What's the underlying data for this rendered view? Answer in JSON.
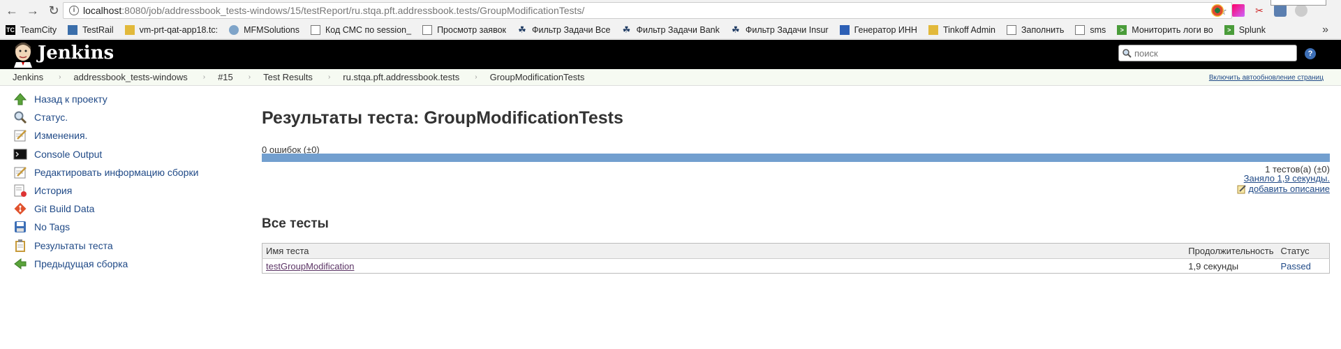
{
  "browser": {
    "url_host": "localhost",
    "url_rest": ":8080/job/addressbook_tests-windows/15/testReport/ru.stqa.pft.addressbook.tests/GroupModificationTests/",
    "bookmarks": [
      {
        "label": "TeamCity",
        "icon": "teamcity-icon",
        "color": "#000000"
      },
      {
        "label": "TestRail",
        "icon": "testrail-icon",
        "color": "#3b6eaa"
      },
      {
        "label": "vm-prt-qat-app18.tc:",
        "icon": "folder-icon",
        "color": "#e2b93b"
      },
      {
        "label": "MFMSolutions",
        "icon": "mfm-icon",
        "color": "#7fa4c9"
      },
      {
        "label": "Код СМС по session_",
        "icon": "page-icon",
        "color": "#ffffff"
      },
      {
        "label": "Просмотр заявок",
        "icon": "page-icon",
        "color": "#ffffff"
      },
      {
        "label": "Фильтр Задачи Все",
        "icon": "jira-icon",
        "color": "#1f3b63"
      },
      {
        "label": "Фильтр Задачи Bank",
        "icon": "jira-icon",
        "color": "#1f3b63"
      },
      {
        "label": "Фильтр Задачи Insur",
        "icon": "jira-icon",
        "color": "#1f3b63"
      },
      {
        "label": "Генератор ИНН",
        "icon": "inn-icon",
        "color": "#2d5fb5"
      },
      {
        "label": "Tinkoff Admin",
        "icon": "folder-icon",
        "color": "#e2b93b"
      },
      {
        "label": "Заполнить",
        "icon": "page-icon",
        "color": "#ffffff"
      },
      {
        "label": "sms",
        "icon": "page-icon",
        "color": "#ffffff"
      },
      {
        "label": "Мониторить логи во",
        "icon": "arrow-icon",
        "color": "#4a9c3a"
      },
      {
        "label": "Splunk",
        "icon": "arrow-icon",
        "color": "#4a9c3a"
      }
    ],
    "more": "»"
  },
  "header": {
    "logo": "Jenkins",
    "search_placeholder": "поиск",
    "help": "?"
  },
  "breadcrumbs": [
    "Jenkins",
    "addressbook_tests-windows",
    "#15",
    "Test Results",
    "ru.stqa.pft.addressbook.tests",
    "GroupModificationTests"
  ],
  "autorefresh": "Включить автообновление страниц",
  "tasks": [
    {
      "label": "Назад к проекту",
      "icon": "up-arrow-icon"
    },
    {
      "label": "Статус.",
      "icon": "magnifier-icon"
    },
    {
      "label": "Изменения.",
      "icon": "notepad-icon"
    },
    {
      "label": "Console Output",
      "icon": "terminal-icon"
    },
    {
      "label": "Редактировать информацию сборки",
      "icon": "notepad-icon"
    },
    {
      "label": "История",
      "icon": "history-icon"
    },
    {
      "label": "Git Build Data",
      "icon": "git-icon"
    },
    {
      "label": "No Tags",
      "icon": "save-icon"
    },
    {
      "label": "Результаты теста",
      "icon": "clipboard-icon"
    },
    {
      "label": "Предыдущая сборка",
      "icon": "left-arrow-icon"
    }
  ],
  "main": {
    "title": "Результаты теста: GroupModificationTests",
    "failures": "0 ошибок (±0)",
    "pass_fraction": 1.0,
    "tests_count": "1 тестов(а) (±0)",
    "took": "Заняло 1,9 секунды.",
    "add_description": "добавить описание",
    "all_tests": "Все тесты",
    "columns": {
      "name": "Имя теста",
      "duration": "Продолжительность",
      "status": "Статус"
    },
    "rows": [
      {
        "name": "testGroupModification",
        "duration": "1,9 секунды",
        "status": "Passed"
      }
    ]
  },
  "colors": {
    "bar": "#729fcf",
    "link": "#204a87"
  }
}
